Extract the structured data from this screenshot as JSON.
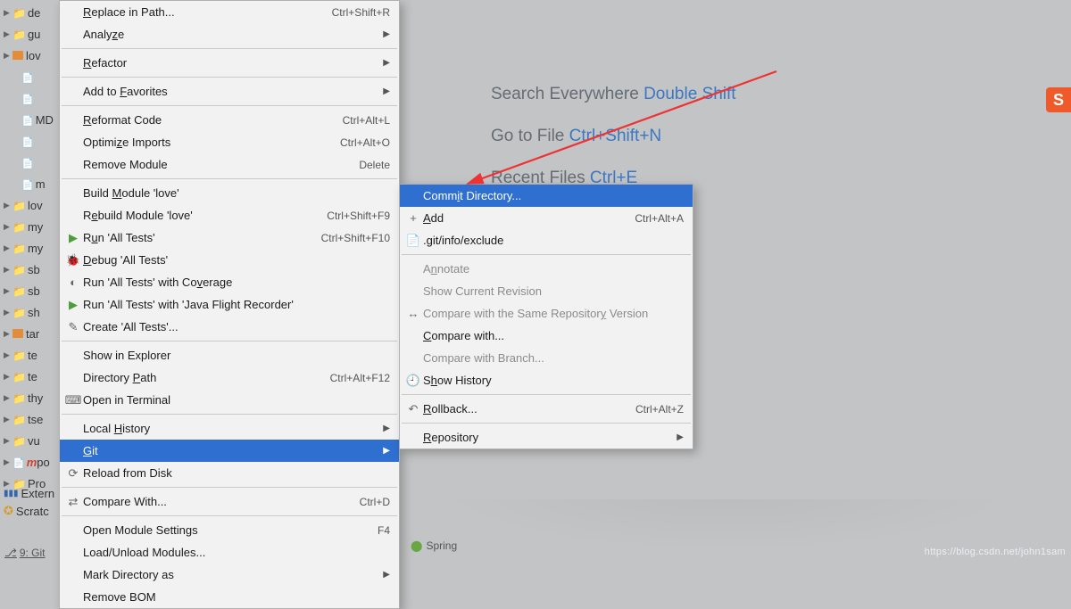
{
  "project_tree": {
    "rows": [
      {
        "icon": "folder-blue",
        "label": "de"
      },
      {
        "icon": "folder-blue",
        "label": "gu"
      },
      {
        "icon": "folder-orange",
        "label": "lov"
      },
      {
        "icon": "file",
        "label": "",
        "indent": 2
      },
      {
        "icon": "file",
        "label": "",
        "indent": 2
      },
      {
        "icon": "file",
        "label": "MD",
        "indent": 2
      },
      {
        "icon": "file",
        "label": "",
        "indent": 2
      },
      {
        "icon": "file",
        "label": "",
        "indent": 2
      },
      {
        "icon": "file",
        "label": "m",
        "indent": 2
      },
      {
        "icon": "folder-blue",
        "label": "lov"
      },
      {
        "icon": "folder-blue",
        "label": "my"
      },
      {
        "icon": "folder-blue",
        "label": "my"
      },
      {
        "icon": "folder-blue",
        "label": "sb"
      },
      {
        "icon": "folder-blue",
        "label": "sb"
      },
      {
        "icon": "folder-blue",
        "label": "sh"
      },
      {
        "icon": "folder-orange",
        "label": "tar"
      },
      {
        "icon": "folder-blue",
        "label": "te"
      },
      {
        "icon": "folder-blue",
        "label": "te"
      },
      {
        "icon": "folder-blue",
        "label": "thy"
      },
      {
        "icon": "folder-blue",
        "label": "tse"
      },
      {
        "icon": "folder-blue",
        "label": "vu"
      },
      {
        "icon": "file",
        "label": "po",
        "prefix": "m"
      },
      {
        "icon": "folder-blue",
        "label": "Pro"
      }
    ]
  },
  "menu": {
    "items": [
      {
        "label": "Replace in Path...",
        "sc": "Ctrl+Shift+R",
        "accel": "R"
      },
      {
        "label": "Analyze",
        "sub": true,
        "accel": "z"
      },
      {
        "sep": true
      },
      {
        "label": "Refactor",
        "sub": true,
        "accel": "R"
      },
      {
        "sep": true
      },
      {
        "label": "Add to Favorites",
        "sub": true,
        "accel": "F"
      },
      {
        "sep": true
      },
      {
        "label": "Reformat Code",
        "sc": "Ctrl+Alt+L",
        "accel": "R"
      },
      {
        "label": "Optimize Imports",
        "sc": "Ctrl+Alt+O",
        "accel": "z"
      },
      {
        "label": "Remove Module",
        "sc": "Delete"
      },
      {
        "sep": true
      },
      {
        "label": "Build Module 'love'",
        "accel": "M"
      },
      {
        "label": "Rebuild Module 'love'",
        "sc": "Ctrl+Shift+F9",
        "accel": "e"
      },
      {
        "label": "Run 'All Tests'",
        "sc": "Ctrl+Shift+F10",
        "icon": "▶",
        "iconColor": "#4b9e3a",
        "accel": "u"
      },
      {
        "label": "Debug 'All Tests'",
        "icon": "🐞",
        "accel": "D"
      },
      {
        "label": "Run 'All Tests' with Coverage",
        "icon": "◐",
        "accel": "v"
      },
      {
        "label": "Run 'All Tests' with 'Java Flight Recorder'",
        "icon": "▶",
        "iconColor": "#4b9e3a"
      },
      {
        "label": "Create 'All Tests'...",
        "icon": "✎"
      },
      {
        "sep": true
      },
      {
        "label": "Show in Explorer"
      },
      {
        "label": "Directory Path",
        "sc": "Ctrl+Alt+F12",
        "accel": "P"
      },
      {
        "label": "Open in Terminal",
        "icon": "⌨"
      },
      {
        "sep": true
      },
      {
        "label": "Local History",
        "sub": true,
        "accel": "H"
      },
      {
        "label": "Git",
        "sub": true,
        "accel": "G",
        "hover": true
      },
      {
        "label": "Reload from Disk",
        "icon": "⟳"
      },
      {
        "sep": true
      },
      {
        "label": "Compare With...",
        "sc": "Ctrl+D",
        "icon": "⇄"
      },
      {
        "sep": true
      },
      {
        "label": "Open Module Settings",
        "sc": "F4"
      },
      {
        "label": "Load/Unload Modules..."
      },
      {
        "label": "Mark Directory as",
        "sub": true
      },
      {
        "label": "Remove BOM"
      }
    ]
  },
  "submenu": {
    "items": [
      {
        "label": "Commit Directory...",
        "hover": true,
        "accel": "i"
      },
      {
        "label": "Add",
        "sc": "Ctrl+Alt+A",
        "icon": "+",
        "accel": "A"
      },
      {
        "label": ".git/info/exclude",
        "icon": "📄"
      },
      {
        "sep": true
      },
      {
        "label": "Annotate",
        "dis": true,
        "accel": "n"
      },
      {
        "label": "Show Current Revision",
        "dis": true
      },
      {
        "label": "Compare with the Same Repository Version",
        "dis": true,
        "icon": "↔",
        "accel": "y"
      },
      {
        "label": "Compare with...",
        "accel": "C"
      },
      {
        "label": "Compare with Branch...",
        "dis": true
      },
      {
        "label": "Show History",
        "icon": "🕘",
        "accel": "H"
      },
      {
        "sep": true
      },
      {
        "label": "Rollback...",
        "sc": "Ctrl+Alt+Z",
        "icon": "↶",
        "accel": "R"
      },
      {
        "sep": true
      },
      {
        "label": "Repository",
        "sub": true,
        "accel": "R"
      }
    ]
  },
  "welcome": {
    "l1a": "Search Everywhere ",
    "l1b": "Double Shift",
    "l2a": "Go to File ",
    "l2b": "Ctrl+Shift+N",
    "l3a": "Recent Files ",
    "l3b": "Ctrl+E"
  },
  "external": {
    "l1": "Extern",
    "l2": "Scratc"
  },
  "bottom": {
    "git_label": "9: Git"
  },
  "spring": {
    "label": "Spring"
  },
  "side": {
    "label": "S"
  },
  "watermark": "https://blog.csdn.net/john1sam"
}
